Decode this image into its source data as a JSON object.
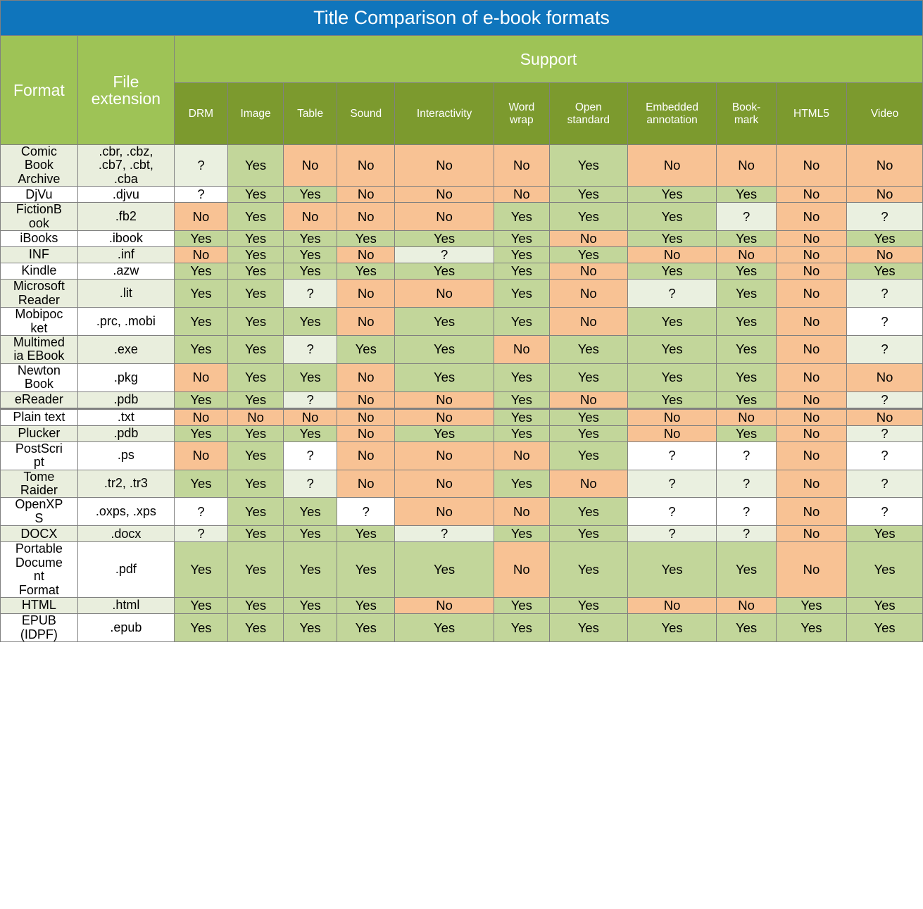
{
  "title": "Title Comparison of e-book formats",
  "colors": {
    "title_band": "#0f75bc",
    "group_header": "#9ec356",
    "sub_header": "#7c9a2e",
    "yes": "#c2d69a",
    "no": "#f8c294",
    "unknown_tint": "#eaf0e0",
    "row_tint": "#e9eedd",
    "grid": "#808080",
    "header_text": "#ffffff",
    "body_text": "#000000"
  },
  "headers": {
    "format": "Format",
    "file_extension": "File\nextension",
    "format_line1": "Format",
    "ext_line1": "File",
    "ext_line2": "extension",
    "support_group": "Support",
    "support_columns": [
      {
        "label": "DRM",
        "lines": [
          "DRM"
        ]
      },
      {
        "label": "Image",
        "lines": [
          "Image"
        ]
      },
      {
        "label": "Table",
        "lines": [
          "Table"
        ]
      },
      {
        "label": "Sound",
        "lines": [
          "Sound"
        ]
      },
      {
        "label": "Interactivity",
        "lines": [
          "Interactivity"
        ]
      },
      {
        "label": "Word wrap",
        "lines": [
          "Word",
          "wrap"
        ]
      },
      {
        "label": "Open standard",
        "lines": [
          "Open",
          "standard"
        ]
      },
      {
        "label": "Embedded annotation",
        "lines": [
          "Embedded",
          "annotation"
        ]
      },
      {
        "label": "Bookmark",
        "lines": [
          "Book-",
          "mark"
        ]
      },
      {
        "label": "HTML5",
        "lines": [
          "HTML5"
        ]
      },
      {
        "label": "Video",
        "lines": [
          "Video"
        ]
      }
    ]
  },
  "legend": {
    "yes": "Yes",
    "no": "No",
    "unknown": "?"
  },
  "rows": [
    {
      "format": "Comic Book Archive",
      "format_lines": [
        "Comic",
        "Book",
        "Archive"
      ],
      "extension": ".cbr, .cbz, .cb7, .cbt, .cba",
      "extension_lines": [
        ".cbr, .cbz,",
        ".cb7, .cbt,",
        ".cba"
      ],
      "values": [
        "?",
        "Yes",
        "No",
        "No",
        "No",
        "No",
        "Yes",
        "No",
        "No",
        "No",
        "No"
      ],
      "tint": "b",
      "section_break": false
    },
    {
      "format": "DjVu",
      "format_lines": [
        "DjVu"
      ],
      "extension": ".djvu",
      "extension_lines": [
        ".djvu"
      ],
      "values": [
        "?",
        "Yes",
        "Yes",
        "No",
        "No",
        "No",
        "Yes",
        "Yes",
        "Yes",
        "No",
        "No"
      ],
      "tint": "a",
      "section_break": false
    },
    {
      "format": "FictionBook",
      "format_lines": [
        "FictionB",
        "ook"
      ],
      "extension": ".fb2",
      "extension_lines": [
        ".fb2"
      ],
      "values": [
        "No",
        "Yes",
        "No",
        "No",
        "No",
        "Yes",
        "Yes",
        "Yes",
        "?",
        "No",
        "?"
      ],
      "tint": "b",
      "section_break": false
    },
    {
      "format": "iBooks",
      "format_lines": [
        "iBooks"
      ],
      "extension": ".ibook",
      "extension_lines": [
        ".ibook"
      ],
      "values": [
        "Yes",
        "Yes",
        "Yes",
        "Yes",
        "Yes",
        "Yes",
        "No",
        "Yes",
        "Yes",
        "No",
        "Yes"
      ],
      "tint": "a",
      "section_break": false
    },
    {
      "format": "INF",
      "format_lines": [
        "INF"
      ],
      "extension": ".inf",
      "extension_lines": [
        ".inf"
      ],
      "values": [
        "No",
        "Yes",
        "Yes",
        "No",
        "?",
        "Yes",
        "Yes",
        "No",
        "No",
        "No",
        "No"
      ],
      "tint": "b",
      "section_break": false
    },
    {
      "format": "Kindle",
      "format_lines": [
        "Kindle"
      ],
      "extension": ".azw",
      "extension_lines": [
        ".azw"
      ],
      "values": [
        "Yes",
        "Yes",
        "Yes",
        "Yes",
        "Yes",
        "Yes",
        "No",
        "Yes",
        "Yes",
        "No",
        "Yes"
      ],
      "tint": "a",
      "section_break": false
    },
    {
      "format": "Microsoft Reader",
      "format_lines": [
        "Microsoft",
        "Reader"
      ],
      "extension": ".lit",
      "extension_lines": [
        ".lit"
      ],
      "values": [
        "Yes",
        "Yes",
        "?",
        "No",
        "No",
        "Yes",
        "No",
        "?",
        "Yes",
        "No",
        "?"
      ],
      "tint": "b",
      "section_break": false
    },
    {
      "format": "Mobipocket",
      "format_lines": [
        "Mobipoc",
        "ket"
      ],
      "extension": ".prc, .mobi",
      "extension_lines": [
        ".prc, .mobi"
      ],
      "values": [
        "Yes",
        "Yes",
        "Yes",
        "No",
        "Yes",
        "Yes",
        "No",
        "Yes",
        "Yes",
        "No",
        "?"
      ],
      "tint": "a",
      "section_break": false
    },
    {
      "format": "Multimedia EBook",
      "format_lines": [
        "Multimed",
        "ia EBook"
      ],
      "extension": ".exe",
      "extension_lines": [
        ".exe"
      ],
      "values": [
        "Yes",
        "Yes",
        "?",
        "Yes",
        "Yes",
        "No",
        "Yes",
        "Yes",
        "Yes",
        "No",
        "?"
      ],
      "tint": "b",
      "section_break": false
    },
    {
      "format": "Newton Book",
      "format_lines": [
        "Newton",
        "Book"
      ],
      "extension": ".pkg",
      "extension_lines": [
        ".pkg"
      ],
      "values": [
        "No",
        "Yes",
        "Yes",
        "No",
        "Yes",
        "Yes",
        "Yes",
        "Yes",
        "Yes",
        "No",
        "No"
      ],
      "tint": "a",
      "section_break": false
    },
    {
      "format": "eReader",
      "format_lines": [
        "eReader"
      ],
      "extension": ".pdb",
      "extension_lines": [
        ".pdb"
      ],
      "values": [
        "Yes",
        "Yes",
        "?",
        "No",
        "No",
        "Yes",
        "No",
        "Yes",
        "Yes",
        "No",
        "?"
      ],
      "tint": "b",
      "section_break": false
    },
    {
      "format": "Plain text",
      "format_lines": [
        "Plain text"
      ],
      "extension": ".txt",
      "extension_lines": [
        ".txt"
      ],
      "values": [
        "No",
        "No",
        "No",
        "No",
        "No",
        "Yes",
        "Yes",
        "No",
        "No",
        "No",
        "No"
      ],
      "tint": "a",
      "section_break": true
    },
    {
      "format": "Plucker",
      "format_lines": [
        "Plucker"
      ],
      "extension": ".pdb",
      "extension_lines": [
        ".pdb"
      ],
      "values": [
        "Yes",
        "Yes",
        "Yes",
        "No",
        "Yes",
        "Yes",
        "Yes",
        "No",
        "Yes",
        "No",
        "?"
      ],
      "tint": "b",
      "section_break": false
    },
    {
      "format": "PostScript",
      "format_lines": [
        "PostScri",
        "pt"
      ],
      "extension": ".ps",
      "extension_lines": [
        ".ps"
      ],
      "values": [
        "No",
        "Yes",
        "?",
        "No",
        "No",
        "No",
        "Yes",
        "?",
        "?",
        "No",
        "?"
      ],
      "tint": "a",
      "section_break": false
    },
    {
      "format": "Tome Raider",
      "format_lines": [
        "Tome",
        "Raider"
      ],
      "extension": ".tr2, .tr3",
      "extension_lines": [
        ".tr2, .tr3"
      ],
      "values": [
        "Yes",
        "Yes",
        "?",
        "No",
        "No",
        "Yes",
        "No",
        "?",
        "?",
        "No",
        "?"
      ],
      "tint": "b",
      "section_break": false
    },
    {
      "format": "OpenXPS",
      "format_lines": [
        "OpenXP",
        "S"
      ],
      "extension": ".oxps, .xps",
      "extension_lines": [
        ".oxps, .xps"
      ],
      "values": [
        "?",
        "Yes",
        "Yes",
        "?",
        "No",
        "No",
        "Yes",
        "?",
        "?",
        "No",
        "?"
      ],
      "tint": "a",
      "section_break": false
    },
    {
      "format": "DOCX",
      "format_lines": [
        "DOCX"
      ],
      "extension": ".docx",
      "extension_lines": [
        ".docx"
      ],
      "values": [
        "?",
        "Yes",
        "Yes",
        "Yes",
        "?",
        "Yes",
        "Yes",
        "?",
        "?",
        "No",
        "Yes"
      ],
      "tint": "b",
      "section_break": false
    },
    {
      "format": "Portable Document Format",
      "format_lines": [
        "Portable",
        "Docume",
        "nt",
        "Format"
      ],
      "extension": ".pdf",
      "extension_lines": [
        ".pdf"
      ],
      "values": [
        "Yes",
        "Yes",
        "Yes",
        "Yes",
        "Yes",
        "No",
        "Yes",
        "Yes",
        "Yes",
        "No",
        "Yes"
      ],
      "tint": "a",
      "section_break": false
    },
    {
      "format": "HTML",
      "format_lines": [
        "HTML"
      ],
      "extension": ".html",
      "extension_lines": [
        ".html"
      ],
      "values": [
        "Yes",
        "Yes",
        "Yes",
        "Yes",
        "No",
        "Yes",
        "Yes",
        "No",
        "No",
        "Yes",
        "Yes"
      ],
      "tint": "b",
      "section_break": false
    },
    {
      "format": "EPUB (IDPF)",
      "format_lines": [
        "EPUB",
        "(IDPF)"
      ],
      "extension": ".epub",
      "extension_lines": [
        ".epub"
      ],
      "values": [
        "Yes",
        "Yes",
        "Yes",
        "Yes",
        "Yes",
        "Yes",
        "Yes",
        "Yes",
        "Yes",
        "Yes",
        "Yes"
      ],
      "tint": "a",
      "section_break": false
    }
  ]
}
